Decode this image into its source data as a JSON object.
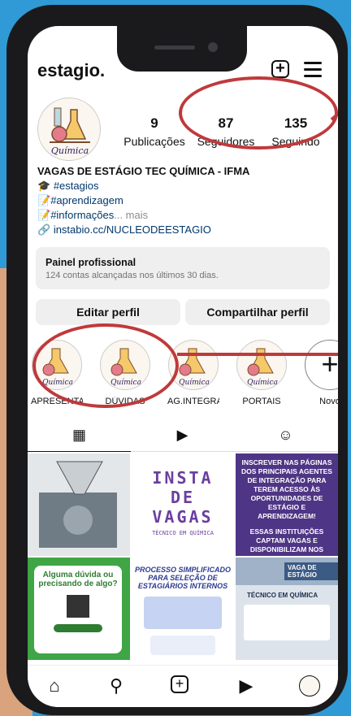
{
  "profile": {
    "username": "estagio.",
    "stats": [
      {
        "value": "9",
        "label": "Publicações"
      },
      {
        "value": "87",
        "label": "Seguidores"
      },
      {
        "value": "135",
        "label": "Seguindo"
      }
    ],
    "name": "VAGAS DE ESTÁGIO TEC QUÍMICA - IFMA",
    "bio": [
      {
        "emoji": "🎓",
        "text": "#estagios"
      },
      {
        "emoji": "📝",
        "text": "#aprendizagem"
      },
      {
        "emoji": "📝",
        "text": "#informações",
        "more": "... mais"
      }
    ],
    "link": "instabio.cc/NUCLEODEESTAGIO",
    "avatar_text": "Química"
  },
  "panel": {
    "title": "Painel profissional",
    "subtitle": "124 contas alcançadas nos últimos 30 dias."
  },
  "buttons": {
    "edit": "Editar perfil",
    "share": "Compartilhar perfil"
  },
  "highlights": [
    {
      "label": "APRESENTAC...",
      "icon_text": "Química"
    },
    {
      "label": "DÚVIDAS",
      "icon_text": "Química"
    },
    {
      "label": "AG.INTEGRA...",
      "icon_text": "Química"
    },
    {
      "label": "PORTAIS",
      "icon_text": "Química"
    },
    {
      "label": "Novo"
    }
  ],
  "tabs": [
    "grid-icon",
    "reels-icon",
    "tagged-icon"
  ],
  "posts": {
    "p2": {
      "line1": "INSTA",
      "line2": "DE",
      "line3": "VAGAS",
      "sub": "TÉCNICO EM QUÍMICA"
    },
    "p3": {
      "text1": "INSCREVER NAS PÁGINAS DOS PRINCIPAIS AGENTES DE INTEGRAÇÃO PARA TEREM ACESSO ÀS OPORTUNIDADES DE ESTÁGIO E APRENDIZAGEM!",
      "text2": "ESSAS INSTITUIÇÕES CAPTAM VAGAS E DISPONIBILIZAM NOS SEUS SITES PARA ESTUDANTES CADASTRADOS."
    },
    "p4": {
      "title": "Alguma dúvida ou precisando de algo?"
    },
    "p5": {
      "title": "PROCESSO SIMPLIFICADO PARA SELEÇÃO DE ESTAGIÁRIOS INTERNOS"
    },
    "p6": {
      "badge": "VAGA DE ESTÁGIO",
      "label": "TÉCNICO EM QUÍMICA"
    }
  },
  "nav": [
    "home-icon",
    "search-icon",
    "create-icon",
    "reels-icon",
    "profile-icon"
  ],
  "colors": {
    "accent_red": "#c0393b",
    "link": "#00376b",
    "background": "#2f9ad6"
  }
}
